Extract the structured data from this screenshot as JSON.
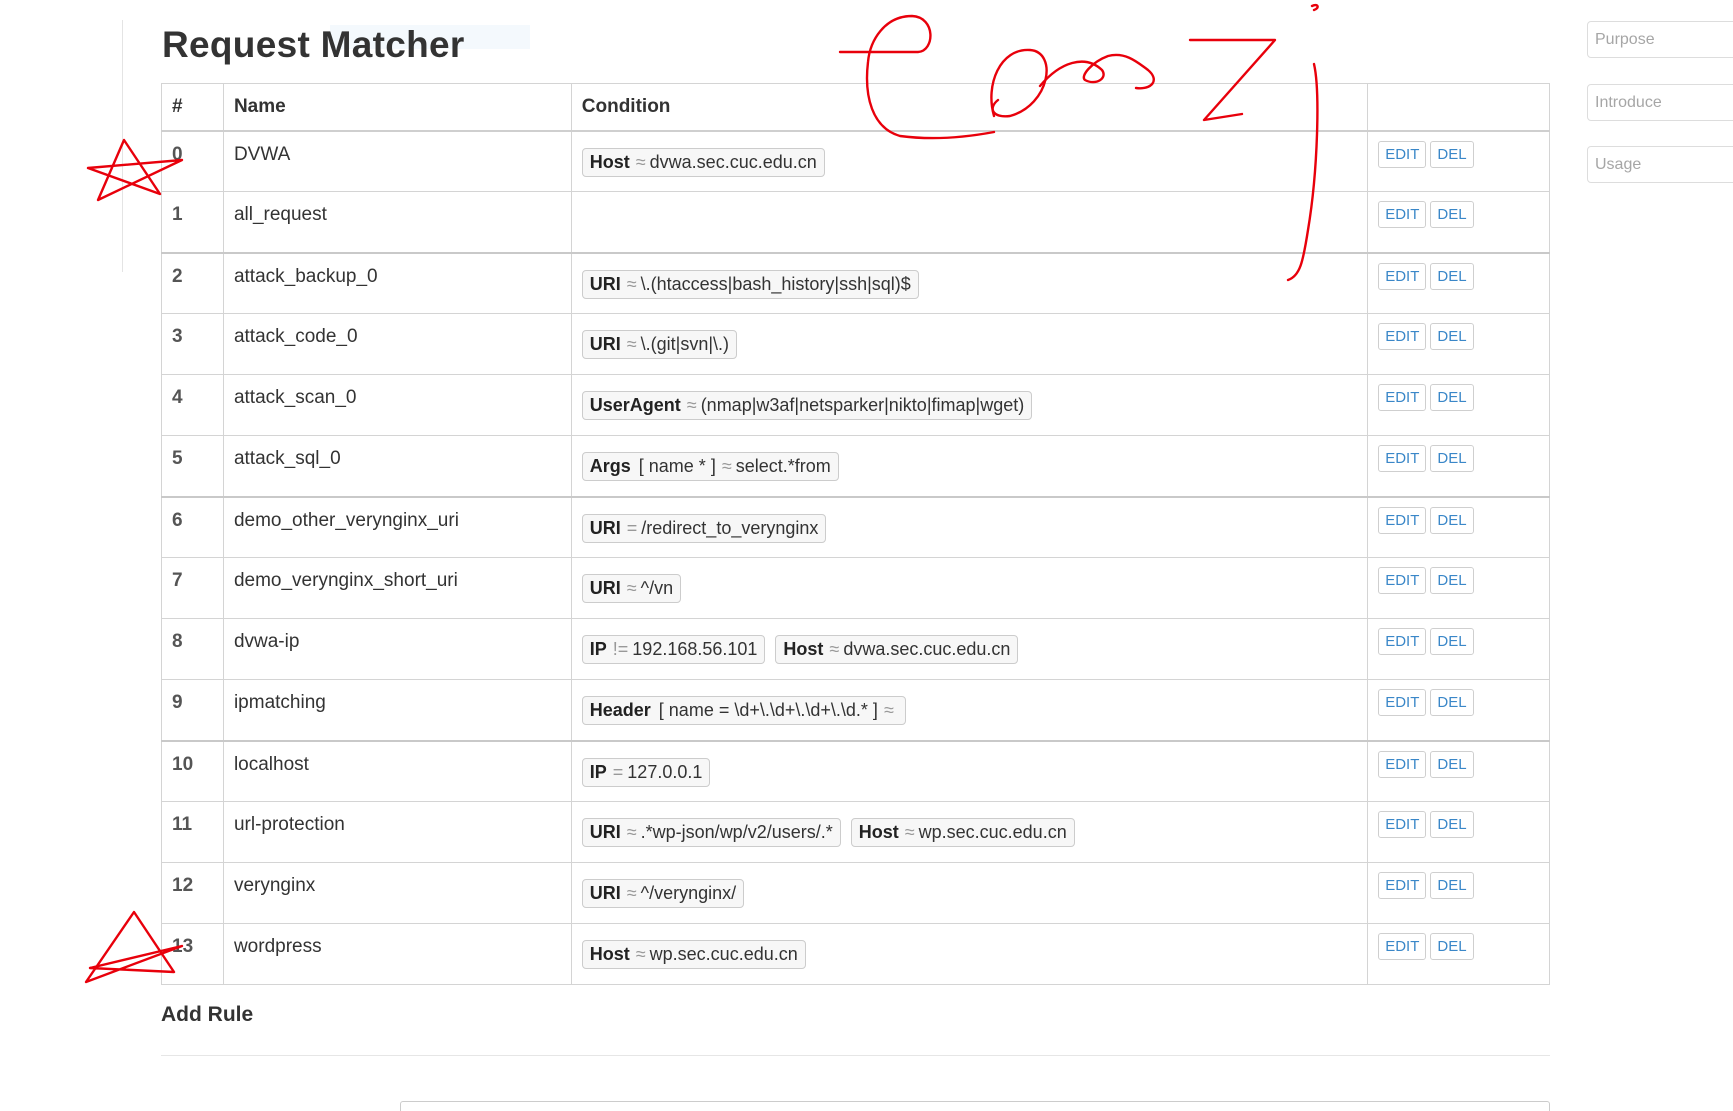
{
  "page": {
    "title": "Request Matcher"
  },
  "table": {
    "headers": {
      "num": "#",
      "name": "Name",
      "condition": "Condition"
    },
    "rows": [
      {
        "num": "0",
        "name": "DVWA",
        "conditions": [
          {
            "key": "Host",
            "op": "≈",
            "value": "dvwa.sec.cuc.edu.cn"
          }
        ]
      },
      {
        "num": "1",
        "name": "all_request",
        "conditions": []
      },
      {
        "num": "2",
        "name": "attack_backup_0",
        "conditions": [
          {
            "key": "URI",
            "op": "≈",
            "value": "\\.(htaccess|bash_history|ssh|sql)$"
          }
        ]
      },
      {
        "num": "3",
        "name": "attack_code_0",
        "conditions": [
          {
            "key": "URI",
            "op": "≈",
            "value": "\\.(git|svn|\\.)"
          }
        ]
      },
      {
        "num": "4",
        "name": "attack_scan_0",
        "conditions": [
          {
            "key": "UserAgent",
            "op": "≈",
            "value": "(nmap|w3af|netsparker|nikto|fimap|wget)"
          }
        ]
      },
      {
        "num": "5",
        "name": "attack_sql_0",
        "conditions": [
          {
            "key": "Args",
            "op": "≈",
            "value": "select.*from",
            "extra": "[ name * ]"
          }
        ]
      },
      {
        "num": "6",
        "name": "demo_other_verynginx_uri",
        "conditions": [
          {
            "key": "URI",
            "op": "=",
            "value": "/redirect_to_verynginx"
          }
        ]
      },
      {
        "num": "7",
        "name": "demo_verynginx_short_uri",
        "conditions": [
          {
            "key": "URI",
            "op": "≈",
            "value": "^/vn"
          }
        ]
      },
      {
        "num": "8",
        "name": "dvwa-ip",
        "conditions": [
          {
            "key": "IP",
            "op": "!=",
            "value": "192.168.56.101"
          },
          {
            "key": "Host",
            "op": "≈",
            "value": "dvwa.sec.cuc.edu.cn"
          }
        ]
      },
      {
        "num": "9",
        "name": "ipmatching",
        "conditions": [
          {
            "key": "Header",
            "op": "≈",
            "value": "",
            "extra": "[ name = \\d+\\.\\d+\\.\\d+\\.\\d.* ]"
          }
        ]
      },
      {
        "num": "10",
        "name": "localhost",
        "conditions": [
          {
            "key": "IP",
            "op": "=",
            "value": "127.0.0.1"
          }
        ]
      },
      {
        "num": "11",
        "name": "url-protection",
        "conditions": [
          {
            "key": "URI",
            "op": "≈",
            "value": ".*wp-json/wp/v2/users/.*"
          },
          {
            "key": "Host",
            "op": "≈",
            "value": "wp.sec.cuc.edu.cn"
          }
        ]
      },
      {
        "num": "12",
        "name": "verynginx",
        "conditions": [
          {
            "key": "URI",
            "op": "≈",
            "value": "^/verynginx/"
          }
        ]
      },
      {
        "num": "13",
        "name": "wordpress",
        "conditions": [
          {
            "key": "Host",
            "op": "≈",
            "value": "wp.sec.cuc.edu.cn"
          }
        ]
      }
    ],
    "actions": {
      "edit": "EDIT",
      "del": "DEL"
    }
  },
  "add_rule": {
    "title": "Add Rule"
  },
  "sidebar": {
    "purpose_placeholder": "Purpose",
    "introduce_placeholder": "Introduce",
    "usage_placeholder": "Usage"
  },
  "annotation": {
    "color": "#e8000b"
  }
}
